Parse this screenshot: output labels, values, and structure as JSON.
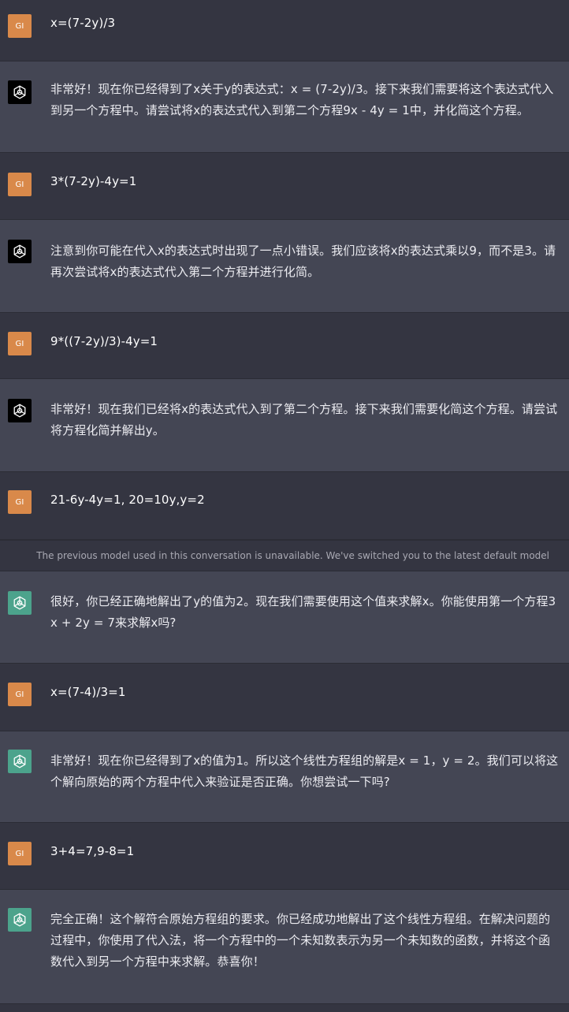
{
  "user": {
    "avatar_initials": "GI"
  },
  "notice": "The previous model used in this conversation is unavailable. We've switched you to the latest default model",
  "messages": [
    {
      "text": "x=(7-2y)/3"
    },
    {
      "text": "非常好！现在你已经得到了x关于y的表达式：x = (7-2y)/3。接下来我们需要将这个表达式代入到另一个方程中。请尝试将x的表达式代入到第二个方程9x - 4y = 1中，并化简这个方程。"
    },
    {
      "text": "3*(7-2y)-4y=1"
    },
    {
      "text": "注意到你可能在代入x的表达式时出现了一点小错误。我们应该将x的表达式乘以9，而不是3。请再次尝试将x的表达式代入第二个方程并进行化简。"
    },
    {
      "text": "9*((7-2y)/3)-4y=1"
    },
    {
      "text": "非常好！现在我们已经将x的表达式代入到了第二个方程。接下来我们需要化简这个方程。请尝试将方程化简并解出y。"
    },
    {
      "text": "21-6y-4y=1, 20=10y,y=2"
    },
    {
      "text": "很好，你已经正确地解出了y的值为2。现在我们需要使用这个值来求解x。你能使用第一个方程3x + 2y = 7来求解x吗?"
    },
    {
      "text": "x=(7-4)/3=1"
    },
    {
      "text": "非常好！现在你已经得到了x的值为1。所以这个线性方程组的解是x = 1，y = 2。我们可以将这个解向原始的两个方程中代入来验证是否正确。你想尝试一下吗?"
    },
    {
      "text": "3+4=7,9-8=1"
    },
    {
      "text": "完全正确！这个解符合原始方程组的要求。你已经成功地解出了这个线性方程组。在解决问题的过程中，你使用了代入法，将一个方程中的一个未知数表示为另一个未知数的函数，并将这个函数代入到另一个方程中来求解。恭喜你！"
    }
  ],
  "colors": {
    "user_row": "#343541",
    "assistant_row": "#444654",
    "user_avatar": "#d9894a",
    "gpt4_avatar": "#000000",
    "gpt35_avatar": "#4ca38c"
  },
  "icons": {
    "assistant_avatar": "openai-logo-icon"
  }
}
